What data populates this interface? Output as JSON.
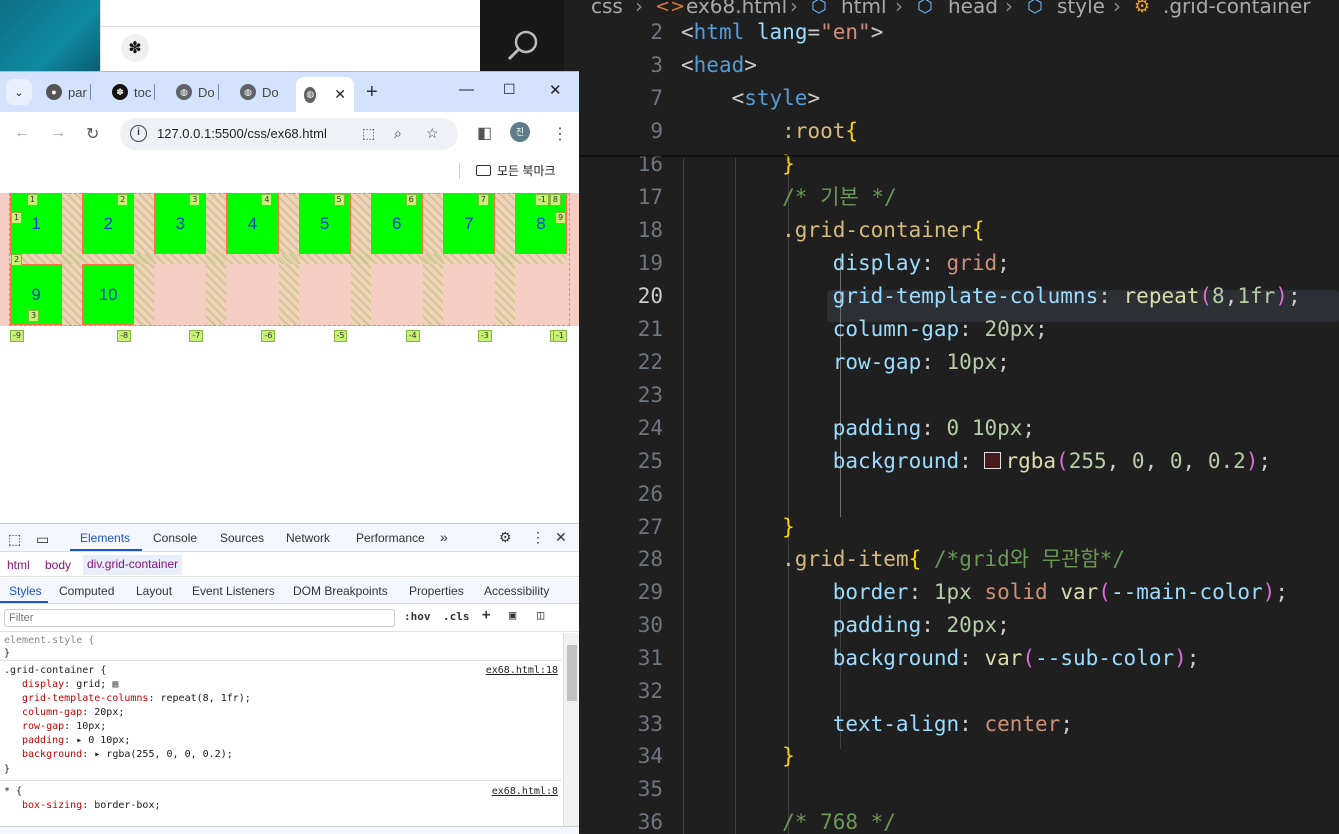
{
  "browser": {
    "tabs": [
      {
        "label": "par",
        "icon": "github-icon"
      },
      {
        "label": "toc",
        "icon": "app-icon"
      },
      {
        "label": "Do",
        "icon": "globe-icon"
      },
      {
        "label": "Do",
        "icon": "globe-icon"
      },
      {
        "label": "",
        "icon": "globe-icon",
        "active": true
      }
    ],
    "new_tab": "+",
    "url": "127.0.0.1:5500/css/ex68.html",
    "bookmarks_label": "모든 북마크",
    "profile_initial": "진"
  },
  "grid": {
    "items": [
      "1",
      "2",
      "3",
      "4",
      "5",
      "6",
      "7",
      "8",
      "9",
      "10"
    ],
    "col_labels_top": [
      "1",
      "2",
      "3",
      "4",
      "5",
      "6",
      "7",
      "8",
      "-1"
    ],
    "col_labels_bottom": [
      "-9",
      "-8",
      "-7",
      "-6",
      "-5",
      "-4",
      "-3",
      "-2",
      "-1"
    ],
    "row_labels": [
      "1",
      "2",
      "3"
    ],
    "right_label": "9"
  },
  "devtools": {
    "tabs": [
      "Elements",
      "Console",
      "Sources",
      "Network",
      "Performance"
    ],
    "breadcrumbs": [
      "html",
      "body",
      "div.grid-container"
    ],
    "subtabs": [
      "Styles",
      "Computed",
      "Layout",
      "Event Listeners",
      "DOM Breakpoints",
      "Properties",
      "Accessibility"
    ],
    "filter_placeholder": "Filter",
    "hov": ":hov",
    "cls": ".cls",
    "rules": {
      "element_style": "element.style {",
      "close": "}",
      "grid_container_selector": ".grid-container {",
      "grid_container_source": "ex68.html:18",
      "props": [
        {
          "name": "display",
          "value": "grid;"
        },
        {
          "name": "grid-template-columns",
          "value": "repeat(8, 1fr);"
        },
        {
          "name": "column-gap",
          "value": "20px;"
        },
        {
          "name": "row-gap",
          "value": "10px;"
        },
        {
          "name": "padding",
          "value": "▸ 0 10px;"
        },
        {
          "name": "background",
          "value": "▸ rgba(255, 0, 0, 0.2);"
        }
      ],
      "universal_selector": "* {",
      "universal_source": "ex68.html:8",
      "universal_prop": "box-sizing",
      "universal_value": "border-box;"
    }
  },
  "editor": {
    "breadcrumb": [
      "css",
      "ex68.html",
      "html",
      "head",
      "style",
      ".grid-container"
    ],
    "lines": [
      {
        "n": "2"
      },
      {
        "n": "3"
      },
      {
        "n": "7"
      },
      {
        "n": "9"
      },
      {
        "n": "16"
      },
      {
        "n": "17"
      },
      {
        "n": "18"
      },
      {
        "n": "19"
      },
      {
        "n": "20"
      },
      {
        "n": "21"
      },
      {
        "n": "22"
      },
      {
        "n": "23"
      },
      {
        "n": "24"
      },
      {
        "n": "25"
      },
      {
        "n": "26"
      },
      {
        "n": "27"
      },
      {
        "n": "28"
      },
      {
        "n": "29"
      },
      {
        "n": "30"
      },
      {
        "n": "31"
      },
      {
        "n": "32"
      },
      {
        "n": "33"
      },
      {
        "n": "34"
      },
      {
        "n": "35"
      },
      {
        "n": "36"
      }
    ],
    "comment_basic": "/* 기본 */",
    "comment_grid_item": "/*grid와 무관함*/",
    "comment_768": "/* 768 */"
  }
}
